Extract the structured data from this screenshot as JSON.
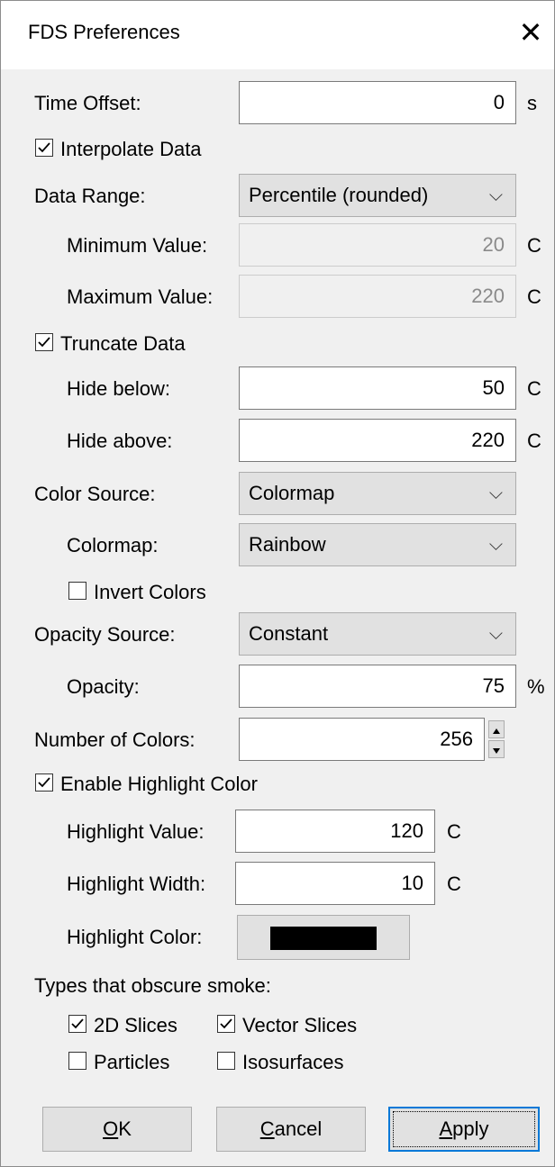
{
  "window": {
    "title": "FDS Preferences",
    "close_glyph": "✕"
  },
  "time_offset": {
    "label": "Time Offset:",
    "value": "0",
    "unit": "s"
  },
  "interpolate_data": {
    "label": "Interpolate Data",
    "checked": true
  },
  "data_range": {
    "label": "Data Range:",
    "selected": "Percentile (rounded)",
    "minimum": {
      "label": "Minimum Value:",
      "value": "20",
      "unit": "C"
    },
    "maximum": {
      "label": "Maximum Value:",
      "value": "220",
      "unit": "C"
    }
  },
  "truncate_data": {
    "label": "Truncate Data",
    "checked": true,
    "hide_below": {
      "label": "Hide below:",
      "value": "50",
      "unit": "C"
    },
    "hide_above": {
      "label": "Hide above:",
      "value": "220",
      "unit": "C"
    }
  },
  "color_source": {
    "label": "Color Source:",
    "selected": "Colormap"
  },
  "colormap": {
    "label": "Colormap:",
    "selected": "Rainbow"
  },
  "invert_colors": {
    "label": "Invert Colors",
    "checked": false
  },
  "opacity_source": {
    "label": "Opacity Source:",
    "selected": "Constant"
  },
  "opacity": {
    "label": "Opacity:",
    "value": "75",
    "unit": "%"
  },
  "number_of_colors": {
    "label": "Number of Colors:",
    "value": "256"
  },
  "highlight": {
    "enable_label": "Enable Highlight Color",
    "checked": true,
    "value": {
      "label": "Highlight Value:",
      "value": "120",
      "unit": "C"
    },
    "width": {
      "label": "Highlight Width:",
      "value": "10",
      "unit": "C"
    },
    "color": {
      "label": "Highlight Color:",
      "swatch": "#000000"
    }
  },
  "obscure": {
    "heading": "Types that obscure smoke:",
    "slices_2d": {
      "label": "2D Slices",
      "checked": true
    },
    "vector_slices": {
      "label": "Vector Slices",
      "checked": true
    },
    "particles": {
      "label": "Particles",
      "checked": false
    },
    "isosurfaces": {
      "label": "Isosurfaces",
      "checked": false
    }
  },
  "buttons": {
    "ok": {
      "accel": "O",
      "rest": "K"
    },
    "cancel": {
      "accel": "C",
      "rest": "ancel"
    },
    "apply": {
      "accel": "A",
      "rest": "pply"
    }
  },
  "colors": {
    "accent": "#0078d7",
    "dialog_bg": "#f0f0f0"
  }
}
